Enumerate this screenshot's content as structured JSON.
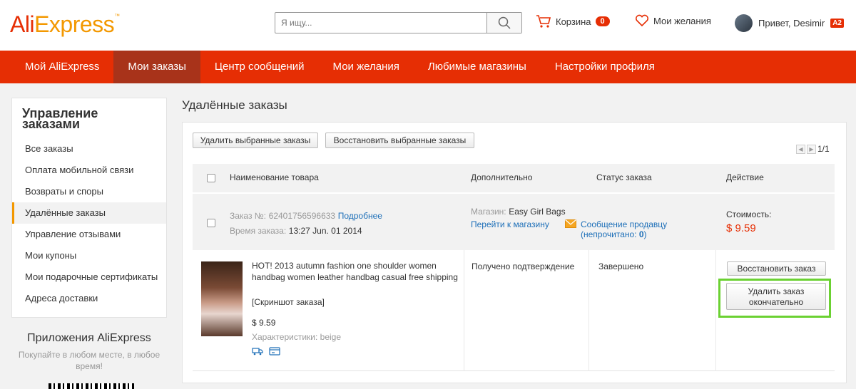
{
  "header": {
    "logo_ali": "Ali",
    "logo_express": "Express",
    "logo_tm": "™",
    "search_placeholder": "Я ищу...",
    "cart_label": "Корзина",
    "cart_count": "0",
    "wishlist_label": "Мои желания",
    "greeting": "Привет, Desimir",
    "level_badge": "A2"
  },
  "nav": {
    "items": [
      "Мой AliExpress",
      "Мои заказы",
      "Центр сообщений",
      "Мои желания",
      "Любимые магазины",
      "Настройки профиля"
    ],
    "active_index": 1
  },
  "sidebar": {
    "title": "Управление заказами",
    "items": [
      "Все заказы",
      "Оплата мобильной связи",
      "Возвраты и споры",
      "Удалённые заказы",
      "Управление отзывами",
      "Мои купоны",
      "Мои подарочные сертификаты",
      "Адреса доставки"
    ],
    "active_index": 3
  },
  "apps": {
    "title": "Приложения AliExpress",
    "subtitle": "Покупайте в любом месте, в любое время!"
  },
  "main": {
    "title": "Удалённые заказы",
    "delete_selected": "Удалить выбранные заказы",
    "restore_selected": "Восстановить выбранные заказы",
    "pager": "1/1",
    "columns": [
      "Наименование товара",
      "Дополнительно",
      "Статус заказа",
      "Действие"
    ]
  },
  "order": {
    "number_label": "Заказ №:",
    "number": "62401756596633",
    "details_link": "Подробнее",
    "time_label": "Время заказа:",
    "time": "13:27 Jun. 01 2014",
    "store_label": "Магазин:",
    "store": "Easy Girl Bags",
    "store_link": "Перейти к магазину",
    "message_link": "Сообщение продавцу",
    "unread_prefix": "(непрочитано: ",
    "unread_count": "0",
    "unread_suffix": ")",
    "cost_label": "Стоимость:",
    "cost": "$ 9.59"
  },
  "item": {
    "title": "HOT! 2013 autumn fashion one shoulder women handbag women leather handbag casual free shipping",
    "snapshot": "[Скриншот заказа]",
    "price": "$ 9.59",
    "specs": "Характеристики: beige",
    "extra": "Получено подтверждение",
    "status": "Завершено",
    "restore_button": "Восстановить заказ",
    "delete_button_line1": "Удалить заказ",
    "delete_button_line2": "окончательно"
  },
  "colors": {
    "brand_red": "#e62e04",
    "nav_active": "#a8331a",
    "logo_orange": "#f39800",
    "link_blue": "#1d6fb8",
    "highlight_green": "#6bd132"
  }
}
